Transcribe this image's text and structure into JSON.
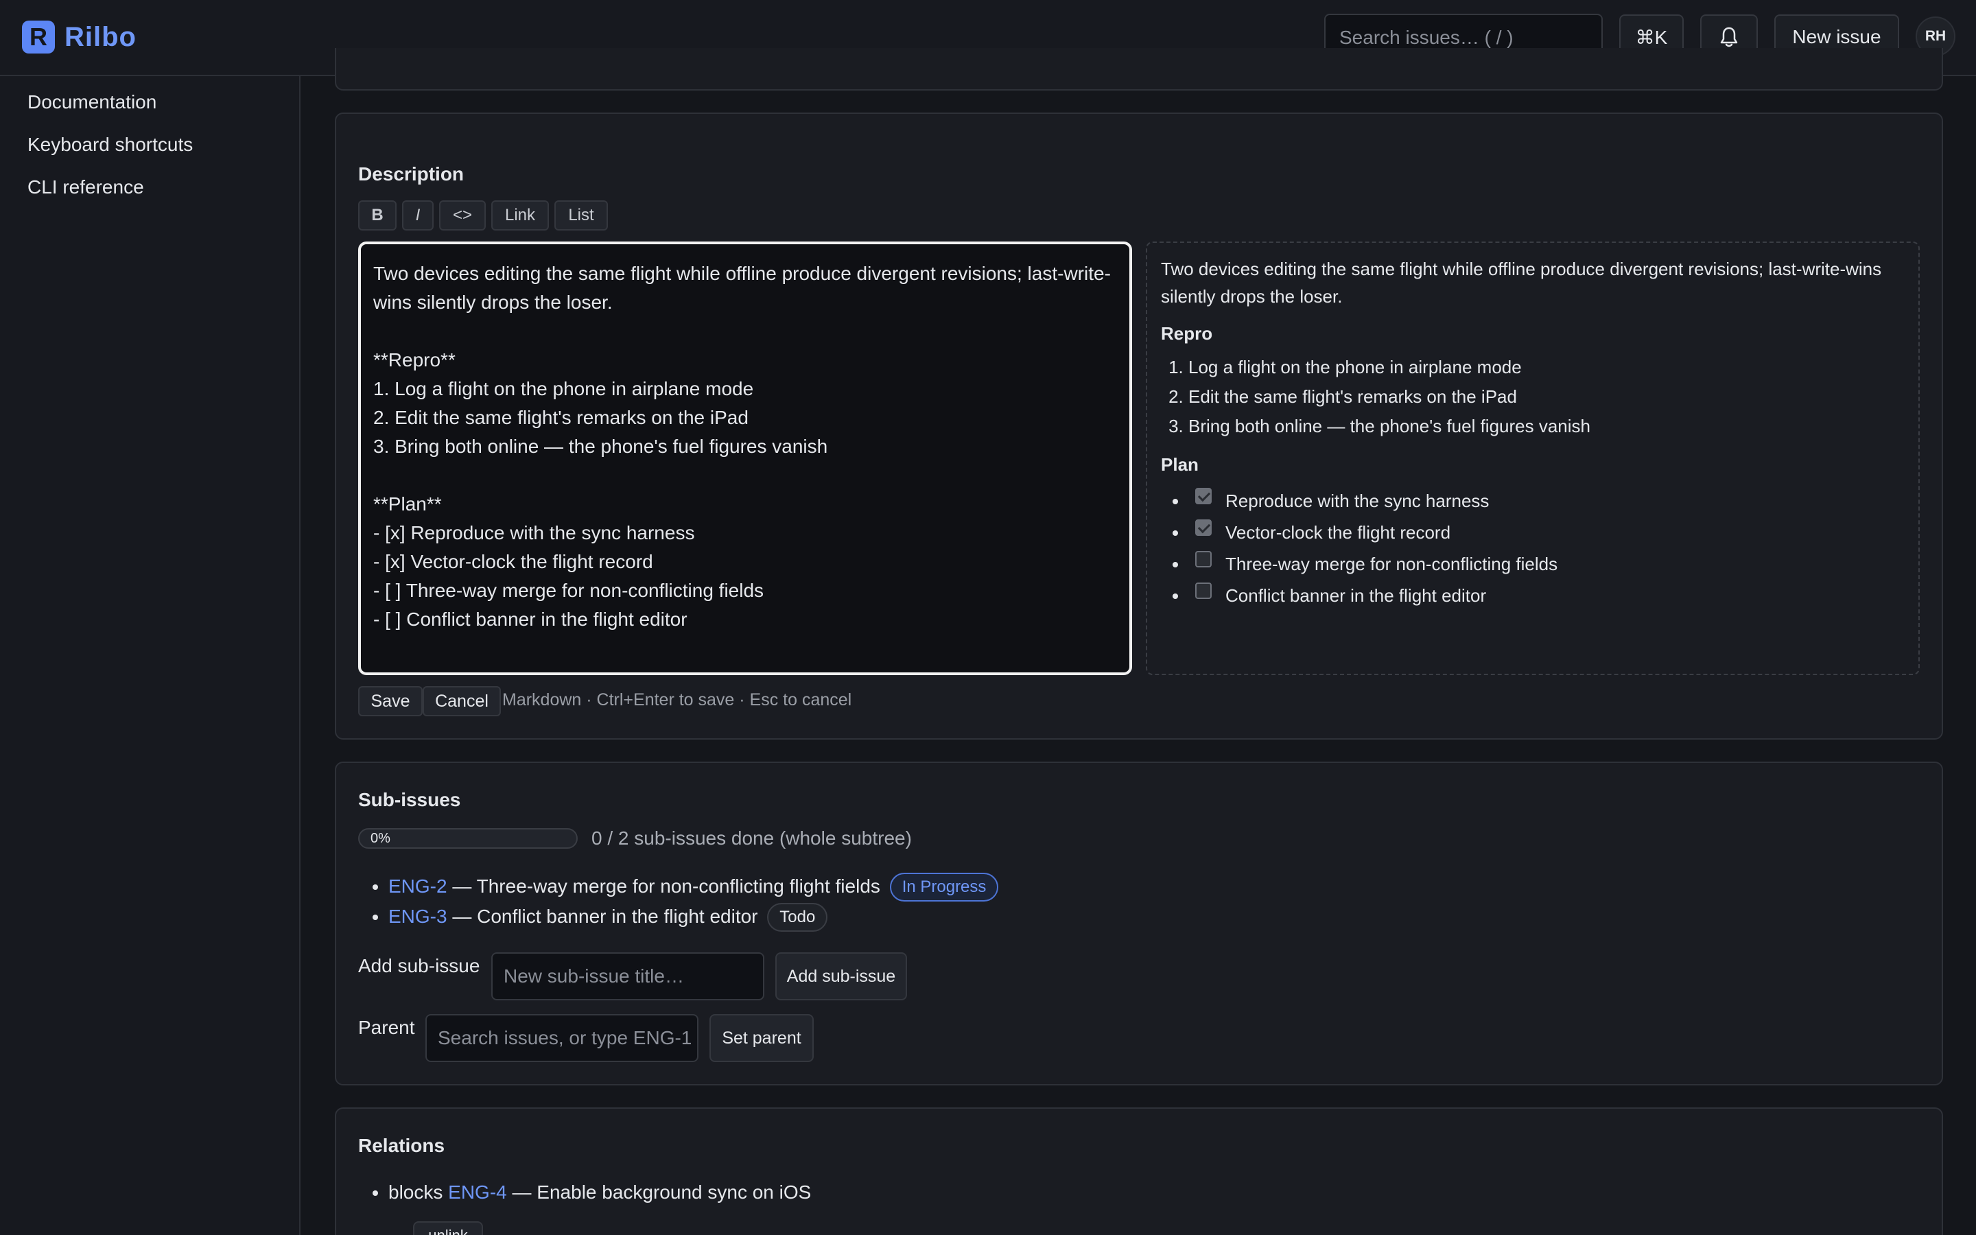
{
  "app": {
    "name": "Rilbo",
    "logo_letter": "R",
    "accent": "#5c86f5"
  },
  "header": {
    "search_placeholder": "Search issues…  ( / )",
    "cmdk_label": "⌘K",
    "bell_icon": "bell-icon",
    "new_issue_label": "New issue",
    "avatar_initials": "RH"
  },
  "sidebar": {
    "items": [
      {
        "label": "Documentation"
      },
      {
        "label": "Keyboard shortcuts"
      },
      {
        "label": "CLI reference"
      }
    ]
  },
  "description": {
    "title": "Description",
    "toolbar": [
      "B",
      "I",
      "<>",
      "Link",
      "List"
    ],
    "editor_text": "Two devices editing the same flight while offline produce divergent revisions; last-write-wins silently drops the loser.\n\n**Repro**\n1. Log a flight on the phone in airplane mode\n2. Edit the same flight's remarks on the iPad\n3. Bring both online — the phone's fuel figures vanish\n\n**Plan**\n- [x] Reproduce with the sync harness\n- [x] Vector-clock the flight record\n- [ ] Three-way merge for non-conflicting fields\n- [ ] Conflict banner in the flight editor",
    "preview": {
      "intro": "Two devices editing the same flight while offline produce divergent revisions; last-write-wins silently drops the loser.",
      "repro_heading": "Repro",
      "repro_steps": [
        "Log a flight on the phone in airplane mode",
        "Edit the same flight's remarks on the iPad",
        "Bring both online — the phone's fuel figures vanish"
      ],
      "plan_heading": "Plan",
      "plan_items": [
        {
          "text": "Reproduce with the sync harness",
          "checked": true
        },
        {
          "text": "Vector-clock the flight record",
          "checked": true
        },
        {
          "text": "Three-way merge for non-conflicting fields",
          "checked": false
        },
        {
          "text": "Conflict banner in the flight editor",
          "checked": false
        }
      ]
    },
    "save_label": "Save",
    "cancel_label": "Cancel",
    "hint": "Markdown · Ctrl+Enter to save · Esc to cancel"
  },
  "subissues": {
    "title": "Sub-issues",
    "progress_percent": 0,
    "progress_label": "0%",
    "progress_text": "0 / 2 sub-issues done (whole subtree)",
    "items": [
      {
        "key": "ENG-2",
        "title": "— Three-way merge for non-conflicting flight fields",
        "status": "In Progress"
      },
      {
        "key": "ENG-3",
        "title": "— Conflict banner in the flight editor",
        "status": "Todo"
      }
    ],
    "add_label": "Add sub-issue",
    "add_placeholder": "New sub-issue title…",
    "add_button": "Add sub-issue",
    "parent_label": "Parent",
    "parent_placeholder": "Search issues, or type ENG-1",
    "parent_button": "Set parent"
  },
  "relations": {
    "title": "Relations",
    "items": [
      {
        "type": "blocks",
        "key": "ENG-4",
        "title": "— Enable background sync on iOS",
        "action": "unlink"
      }
    ]
  }
}
